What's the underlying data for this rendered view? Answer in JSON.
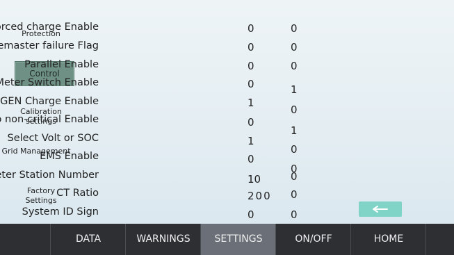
{
  "nav": {
    "items": [
      {
        "label": "Protection"
      },
      {
        "label": "Control"
      },
      {
        "label": "Calibration settings"
      },
      {
        "label": "Grid Management"
      },
      {
        "label": "Factory Settings"
      }
    ],
    "active": "Control"
  },
  "settings": [
    {
      "label": "Forced charge Enable",
      "value1": "0",
      "value2": "0"
    },
    {
      "label": "Shinemaster failure Flag",
      "value1": "0",
      "value2": "0"
    },
    {
      "label": "Parallel Enable",
      "value1": "0",
      "value2": "0"
    },
    {
      "label": "Meter Switch Enable",
      "value1": "0",
      "value2": "1"
    },
    {
      "label": "GEN Charge Enable",
      "value1": "1",
      "value2": "0"
    },
    {
      "label": "Bat to non-critical Enable",
      "value1": "0",
      "value2": "1"
    },
    {
      "label": "Select Volt or SOC",
      "value1": "1",
      "value2": "0"
    },
    {
      "label": "EMS Enable",
      "value1": "0",
      "value2": "0"
    },
    {
      "label": "Meter Station Number",
      "value1": "10",
      "value2": "0"
    },
    {
      "label": "CT Ratio",
      "value1": "200",
      "value2": "0"
    },
    {
      "label": "System ID Sign",
      "value1": "0",
      "value2": "0"
    }
  ],
  "back_button": {
    "icon": "arrow-left-icon",
    "color": "#7fd3c7"
  },
  "tabs": [
    {
      "label": "DATA"
    },
    {
      "label": "WARNINGS"
    },
    {
      "label": "SETTINGS"
    },
    {
      "label": "ON/OFF"
    },
    {
      "label": "HOME"
    }
  ],
  "active_tab": "SETTINGS",
  "colors": {
    "tabbar": "#2d2f33",
    "active_tab": "#6b7078",
    "active_nav": "#6f9185"
  }
}
